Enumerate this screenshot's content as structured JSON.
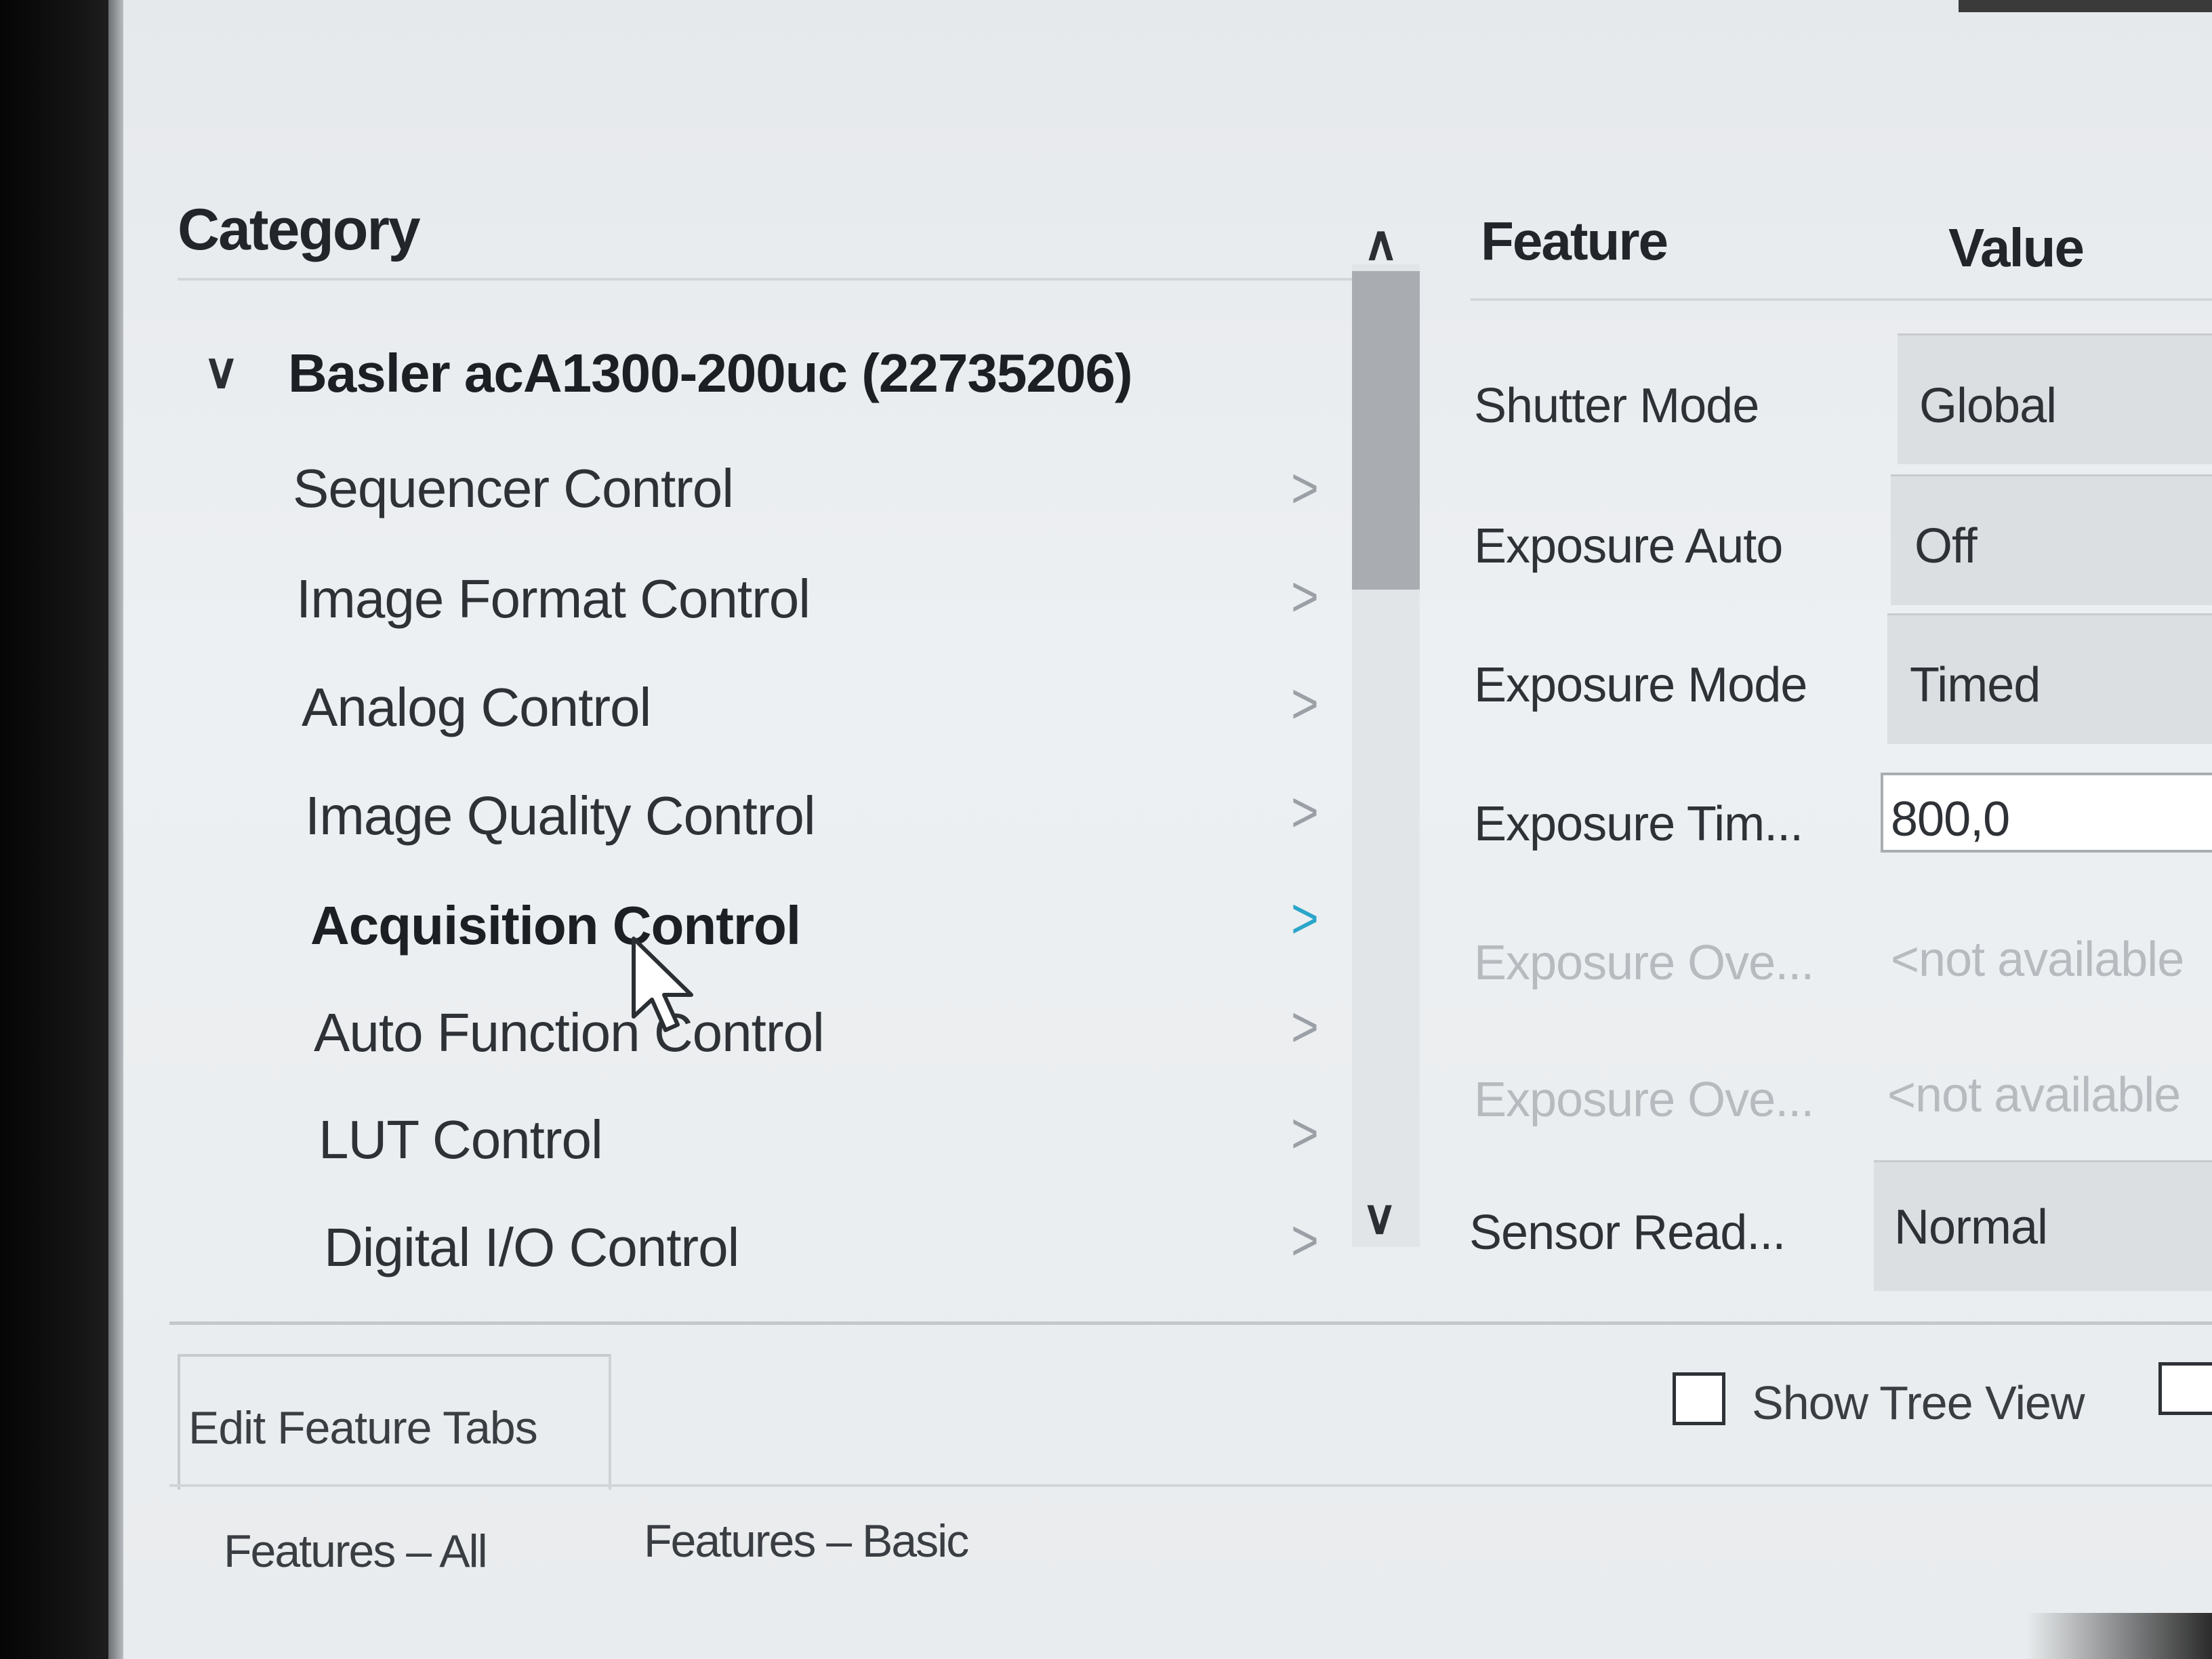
{
  "category_pane": {
    "header": "Category",
    "root": {
      "label": "Basler acA1300-200uc (22735206)"
    },
    "items": [
      {
        "label": "Sequencer Control"
      },
      {
        "label": "Image Format Control"
      },
      {
        "label": "Analog Control"
      },
      {
        "label": "Image Quality Control"
      },
      {
        "label": "Acquisition Control",
        "selected": true
      },
      {
        "label": "Auto Function Control"
      },
      {
        "label": "LUT Control"
      },
      {
        "label": "Digital I/O Control"
      }
    ]
  },
  "feature_pane": {
    "feature_header": "Feature",
    "value_header": "Value",
    "rows": [
      {
        "name": "Shutter Mode",
        "value": "Global"
      },
      {
        "name": "Exposure Auto",
        "value": "Off"
      },
      {
        "name": "Exposure Mode",
        "value": "Timed"
      },
      {
        "name": "Exposure Tim...",
        "value": "800,0"
      },
      {
        "name": "Exposure Ove...",
        "value": "<not available"
      },
      {
        "name": "Exposure Ove...",
        "value": "<not available"
      },
      {
        "name": "Sensor Read...",
        "value": "Normal"
      }
    ]
  },
  "bottom": {
    "edit_button": "Edit Feature Tabs",
    "show_tree_view": "Show Tree View",
    "tabs": [
      "Features – All",
      "Features – Basic"
    ]
  },
  "colors": {
    "accent_chevron": "#2aa6c9"
  }
}
